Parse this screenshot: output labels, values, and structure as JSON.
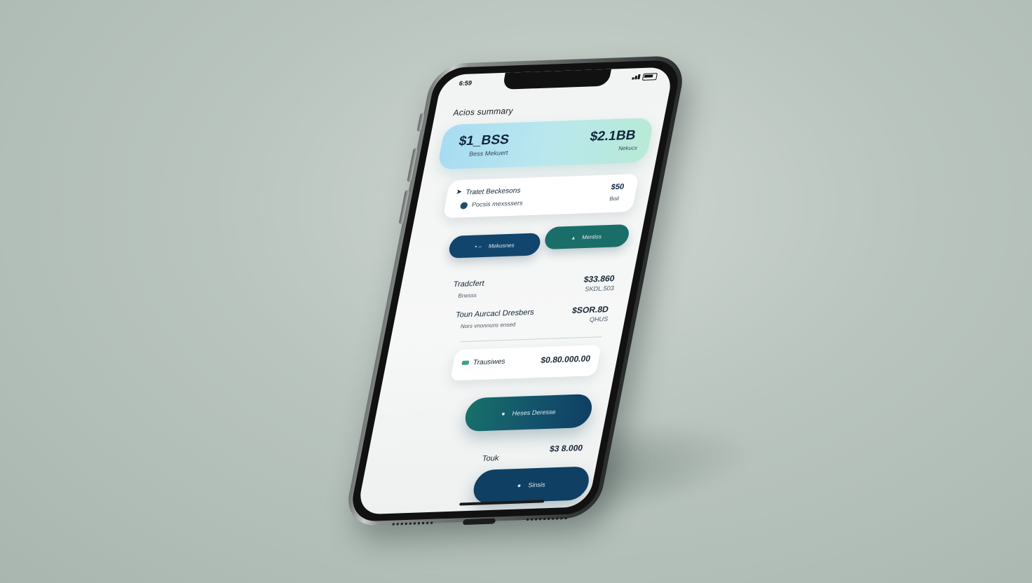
{
  "status_bar": {
    "time": "6:59"
  },
  "screen_title": "Acios summary",
  "balance_card": {
    "left_amount": "$1_BSS",
    "left_label": "Bess Mekuert",
    "right_amount": "$2.1BB",
    "right_label": "Nekucx"
  },
  "transaction_card": {
    "row1": {
      "icon": "arrow-icon",
      "name": "Tratet Beckesons",
      "amount": "$50"
    },
    "row2": {
      "icon": "circle-icon",
      "name": "Pocsis mexsssers",
      "amount": "Boil"
    }
  },
  "actions": {
    "left_label": "Mekusnes",
    "right_label": "Mentiss"
  },
  "list": [
    {
      "name": "Tradcfert",
      "sub": "Bnesss",
      "amount": "$33.860",
      "amount_sub": "SKDL.503"
    },
    {
      "name": "Toun Aurcacl Dresbers",
      "sub": "Nors vnonnuns ensed",
      "amount": "$SOR.8D",
      "amount_sub": "QHUS"
    }
  ],
  "group_row": {
    "name": "Trausiwes",
    "amount": "$0.80.000.00"
  },
  "primary_button": {
    "label": "Heses Deresse"
  },
  "total": {
    "label": "Touk",
    "amount": "$3 8.000"
  },
  "confirm_button": {
    "label": "Sinsis"
  },
  "colors": {
    "navy": "#11456e",
    "teal": "#1a6e69",
    "card_gradient_start": "#a8dcf2",
    "card_gradient_end": "#b8ead6"
  }
}
